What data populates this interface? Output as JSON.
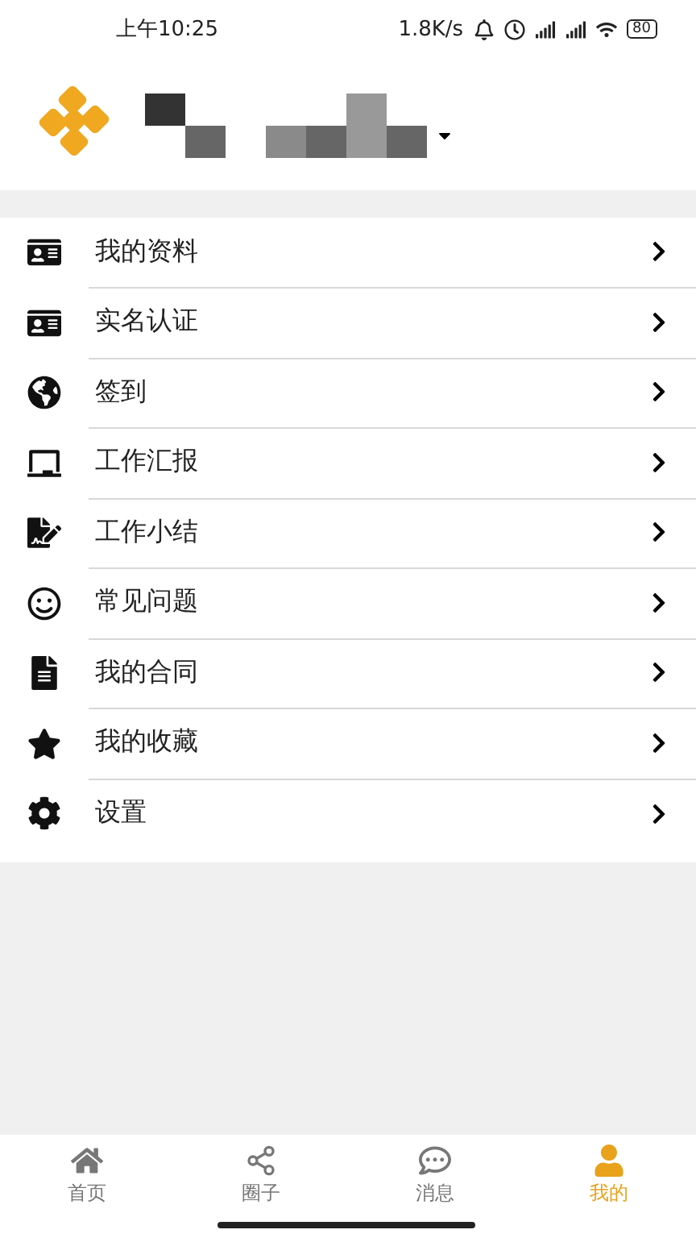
{
  "status_bar": {
    "time": "上午10:25",
    "speed": "1.8K/s",
    "battery": "80"
  },
  "menu": [
    {
      "label": "我的资料"
    },
    {
      "label": "实名认证"
    },
    {
      "label": "签到"
    },
    {
      "label": "工作汇报"
    },
    {
      "label": "工作小结"
    },
    {
      "label": "常见问题"
    },
    {
      "label": "我的合同"
    },
    {
      "label": "我的收藏"
    },
    {
      "label": "设置"
    }
  ],
  "tab_bar": [
    {
      "label": "首页",
      "selected": false
    },
    {
      "label": "圈子",
      "selected": false
    },
    {
      "label": "消息",
      "selected": false
    },
    {
      "label": "我的",
      "selected": true
    }
  ]
}
